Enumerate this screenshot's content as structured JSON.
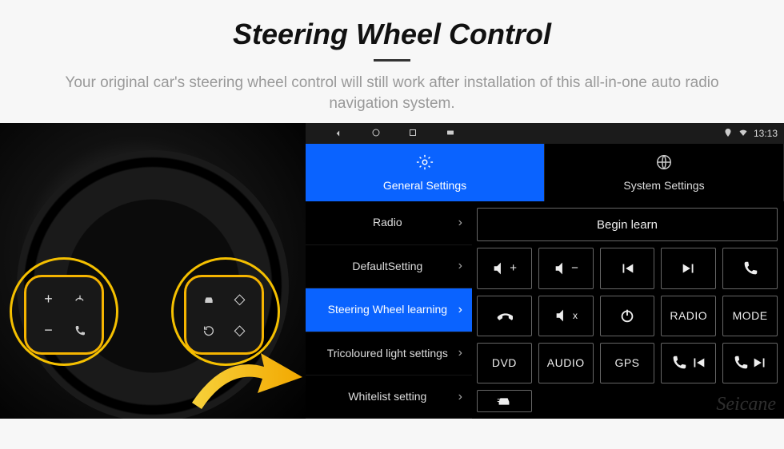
{
  "header": {
    "title": "Steering Wheel Control",
    "description": "Your original car's steering wheel control will still work after installation of this all-in-one auto radio navigation system."
  },
  "wheel_buttons": {
    "left": [
      "plus-icon",
      "voice-icon",
      "minus-icon",
      "phone-icon"
    ],
    "right": [
      "car-icon",
      "diamond-icon",
      "cycle-icon",
      "diamond-icon"
    ]
  },
  "status_bar": {
    "nav_icons": [
      "back-icon",
      "home-icon",
      "recent-icon",
      "card-icon"
    ],
    "right_icons": [
      "location-icon",
      "wifi-icon"
    ],
    "clock": "13:13"
  },
  "tabs": [
    {
      "icon": "gear-icon",
      "label": "General Settings",
      "active": true
    },
    {
      "icon": "globe-icon",
      "label": "System Settings",
      "active": false
    }
  ],
  "menu": [
    {
      "label": "Radio",
      "active": false
    },
    {
      "label": "DefaultSetting",
      "active": false
    },
    {
      "label": "Steering Wheel learning",
      "active": true
    },
    {
      "label": "Tricoloured light settings",
      "active": false
    },
    {
      "label": "Whitelist setting",
      "active": false
    }
  ],
  "begin_button": "Begin learn",
  "grid": [
    [
      "volume-up-icon",
      "volume-down-icon",
      "prev-track-icon",
      "next-track-icon",
      "phone-pickup-icon"
    ],
    [
      "phone-hangup-icon",
      "mute-icon",
      "power-icon",
      "RADIO",
      "MODE"
    ],
    [
      "DVD",
      "AUDIO",
      "GPS",
      "phone-prev-icon",
      "phone-next-icon"
    ],
    [
      "car-list-icon",
      "",
      "",
      "",
      ""
    ]
  ],
  "watermark": "Seicane",
  "colors": {
    "accent": "#0a63ff",
    "highlight": "#f5c000"
  }
}
